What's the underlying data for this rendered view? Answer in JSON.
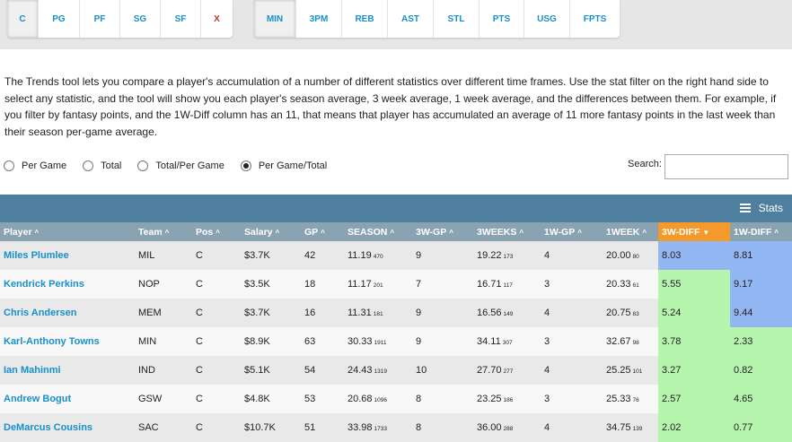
{
  "positions": [
    {
      "label": "C",
      "active": true
    },
    {
      "label": "PG"
    },
    {
      "label": "PF"
    },
    {
      "label": "SG"
    },
    {
      "label": "SF"
    },
    {
      "label": "X",
      "red": true
    }
  ],
  "stats_filters": [
    {
      "label": "MIN",
      "active": true
    },
    {
      "label": "3PM"
    },
    {
      "label": "REB"
    },
    {
      "label": "AST"
    },
    {
      "label": "STL"
    },
    {
      "label": "PTS"
    },
    {
      "label": "USG"
    },
    {
      "label": "FPTS"
    }
  ],
  "description": "The Trends tool lets you compare a player's accumulation of a number of different statistics over different time frames. Use the stat filter on the right hand side to select any statistic, and the tool will show you each player's season average, 3 week average, 1 week average, and the differences between them. For example, if you filter by fantasy points, and the 1W-Diff column has an 11, that means that player has accumulated an average of 11 more fantasy points in the last week than their season per-game average.",
  "radios": [
    {
      "label": "Per Game",
      "selected": false
    },
    {
      "label": "Total",
      "selected": false
    },
    {
      "label": "Total/Per Game",
      "selected": false
    },
    {
      "label": "Per Game/Total",
      "selected": true
    }
  ],
  "search": {
    "label": "Search:",
    "value": ""
  },
  "table_toolbar": {
    "stats_label": "Stats"
  },
  "colors": {
    "header_bar": "#4e7f9e",
    "header_row": "#8aa3b3",
    "sorted": "#f39a2a",
    "link": "#1a8fc9",
    "cell_blue": "#93b7f3",
    "cell_green": "#b5f5ad"
  },
  "table": {
    "columns": [
      "Player",
      "Team",
      "Pos",
      "Salary",
      "GP",
      "SEASON",
      "3W-GP",
      "3WEEKS",
      "1W-GP",
      "1WEEK",
      "3W-DIFF",
      "1W-DIFF"
    ],
    "sorted_column": "3W-DIFF",
    "rows": [
      {
        "player": "Miles Plumlee",
        "team": "MIL",
        "pos": "C",
        "salary": "$3.7K",
        "gp": "42",
        "season": "11.19",
        "season_total": "470",
        "w3gp": "9",
        "w3": "19.22",
        "w3_total": "173",
        "w1gp": "4",
        "w1": "20.00",
        "w1_total": "80",
        "d3": "8.03",
        "d1": "8.81",
        "d3_color": "blue",
        "d1_color": "blue"
      },
      {
        "player": "Kendrick Perkins",
        "team": "NOP",
        "pos": "C",
        "salary": "$3.5K",
        "gp": "18",
        "season": "11.17",
        "season_total": "201",
        "w3gp": "7",
        "w3": "16.71",
        "w3_total": "117",
        "w1gp": "3",
        "w1": "20.33",
        "w1_total": "61",
        "d3": "5.55",
        "d1": "9.17",
        "d3_color": "green",
        "d1_color": "blue"
      },
      {
        "player": "Chris Andersen",
        "team": "MEM",
        "pos": "C",
        "salary": "$3.7K",
        "gp": "16",
        "season": "11.31",
        "season_total": "181",
        "w3gp": "9",
        "w3": "16.56",
        "w3_total": "149",
        "w1gp": "4",
        "w1": "20.75",
        "w1_total": "83",
        "d3": "5.24",
        "d1": "9.44",
        "d3_color": "green",
        "d1_color": "blue"
      },
      {
        "player": "Karl-Anthony Towns",
        "team": "MIN",
        "pos": "C",
        "salary": "$8.9K",
        "gp": "63",
        "season": "30.33",
        "season_total": "1911",
        "w3gp": "9",
        "w3": "34.11",
        "w3_total": "307",
        "w1gp": "3",
        "w1": "32.67",
        "w1_total": "98",
        "d3": "3.78",
        "d1": "2.33",
        "d3_color": "green",
        "d1_color": "green"
      },
      {
        "player": "Ian Mahinmi",
        "team": "IND",
        "pos": "C",
        "salary": "$5.1K",
        "gp": "54",
        "season": "24.43",
        "season_total": "1319",
        "w3gp": "10",
        "w3": "27.70",
        "w3_total": "277",
        "w1gp": "4",
        "w1": "25.25",
        "w1_total": "101",
        "d3": "3.27",
        "d1": "0.82",
        "d3_color": "green",
        "d1_color": "green"
      },
      {
        "player": "Andrew Bogut",
        "team": "GSW",
        "pos": "C",
        "salary": "$4.8K",
        "gp": "53",
        "season": "20.68",
        "season_total": "1096",
        "w3gp": "8",
        "w3": "23.25",
        "w3_total": "186",
        "w1gp": "3",
        "w1": "25.33",
        "w1_total": "76",
        "d3": "2.57",
        "d1": "4.65",
        "d3_color": "green",
        "d1_color": "green"
      },
      {
        "player": "DeMarcus Cousins",
        "team": "SAC",
        "pos": "C",
        "salary": "$10.7K",
        "gp": "51",
        "season": "33.98",
        "season_total": "1733",
        "w3gp": "8",
        "w3": "36.00",
        "w3_total": "288",
        "w1gp": "4",
        "w1": "34.75",
        "w1_total": "139",
        "d3": "2.02",
        "d1": "0.77",
        "d3_color": "green",
        "d1_color": "green"
      }
    ]
  }
}
